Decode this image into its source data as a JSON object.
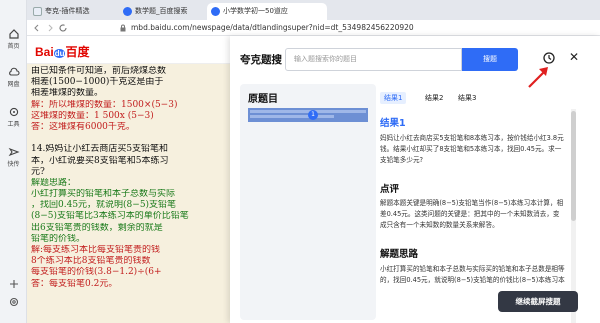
{
  "sidebar": {
    "items": [
      {
        "label": "首页",
        "icon": "home-icon"
      },
      {
        "label": "网盘",
        "icon": "cloud-icon"
      },
      {
        "label": "工具",
        "icon": "tools-icon"
      },
      {
        "label": "快传",
        "icon": "transfer-icon"
      }
    ]
  },
  "tabs": [
    {
      "label": "夸克-插件精选",
      "active": false
    },
    {
      "label": "数学题_百度搜索",
      "active": false
    },
    {
      "label": "小学数学初一50道应",
      "active": true
    }
  ],
  "address": {
    "url": "mbd.baidu.com/newspage/data/dtlandingsuper?nid=dt_534982456220920"
  },
  "baidu_logo": {
    "text_left": "Bai",
    "text_paw": "du",
    "text_right": "百度"
  },
  "document": {
    "lines": [
      {
        "text": "由已知条件可知道，前后烧煤总数",
        "cls": "k"
      },
      {
        "text": "相差(1500−1000)千克这是由于",
        "cls": "k"
      },
      {
        "text": "相差堆煤的数量。",
        "cls": "k"
      },
      {
        "text": "解：所以堆煤的数量：1500×(5−3)",
        "cls": "r"
      },
      {
        "text": "    这堆煤的数量：1 500x (5−3)",
        "cls": "r"
      },
      {
        "text": "答：这堆煤有6000千克。",
        "cls": "r"
      },
      {
        "text": "",
        "cls": "k"
      },
      {
        "text": "14.妈妈让小红去商店买5支铅笔和",
        "cls": "k"
      },
      {
        "text": "本，小红说要买8支铅笔和5本练习",
        "cls": "k"
      },
      {
        "text": "元?",
        "cls": "k"
      },
      {
        "text": "解题思路：",
        "cls": "g"
      },
      {
        "text": "小红打算买的铅笔和本子总数与实际",
        "cls": "g"
      },
      {
        "text": "，找回0.45元，就说明(8−5)支铅笔",
        "cls": "g"
      },
      {
        "text": "(8−5)支铅笔比3本练习本的单价比铅笔",
        "cls": "g"
      },
      {
        "text": "出6支铅笔贵的钱数，剩余的就是",
        "cls": "g"
      },
      {
        "text": "铅笔的价钱。",
        "cls": "g"
      },
      {
        "text": "解:每支练习本比每支铅笔贵的钱",
        "cls": "r"
      },
      {
        "text": "   8个练习本比8支铅笔贵的钱数",
        "cls": "r"
      },
      {
        "text": "   每支铅笔的价钱(3.8−1.2)÷(6+",
        "cls": "r"
      },
      {
        "text": "答：每支铅笔0.2元。",
        "cls": "r"
      }
    ]
  },
  "panel": {
    "title": "夸克题搜",
    "search_placeholder": "输入题搜索你的题目",
    "search_button": "搜题",
    "original_title": "原题目",
    "original_badge": "1",
    "result_tabs": [
      "结果1",
      "结果2",
      "结果3"
    ],
    "sections": [
      {
        "heading": "结果1",
        "blue": true,
        "text": "妈妈让小红去商店买5支铅笔和8本练习本，按价钱给小红3.8元钱。结果小红却买了8支铅笔和5本练习本，找回0.45元。求一支铅笔多少元?"
      },
      {
        "heading": "点评",
        "blue": false,
        "text": "解题本题关键是明确(8−5)支铅笔当作(8−5)本练习本计算，相差0.45元。这类问题的关键是：把其中的一个未知数消去，变成只含有一个未知数的数量关系来解答。"
      },
      {
        "heading": "解题思路",
        "blue": false,
        "text": "小红打算买的铅笔和本子总数与实际买的铅笔和本子总数是相等的，找回0.45元，就说明(8−5)支铅笔的价钱比(8−5)本练习本"
      }
    ],
    "continue_button": "继续截屏搜题"
  },
  "colors": {
    "accent": "#2f6cf6",
    "red_text": "#c21e1e",
    "green_text": "#1a7a1a",
    "dark_button": "#333844"
  }
}
